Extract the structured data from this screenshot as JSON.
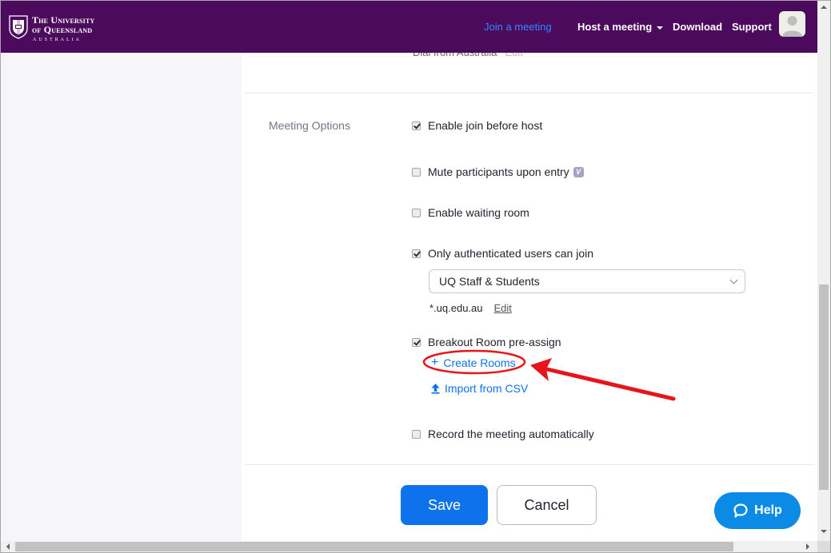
{
  "header": {
    "logo": {
      "line1": "The University",
      "line2": "of Queensland",
      "line3": "AUSTRALIA"
    },
    "nav": {
      "join": "Join a meeting",
      "host": "Host a meeting",
      "download": "Download",
      "support": "Support"
    },
    "colors": {
      "brand": "#4b0a5c",
      "active_link": "#2d8cff"
    }
  },
  "dial": {
    "text": "Dial from Australia",
    "edit": "Edit"
  },
  "meeting_options": {
    "label": "Meeting Options",
    "options": [
      {
        "label": "Enable join before host",
        "checked": true
      },
      {
        "label": "Mute participants upon entry",
        "checked": false,
        "badge": "V"
      },
      {
        "label": "Enable waiting room",
        "checked": false
      },
      {
        "label": "Only authenticated users can join",
        "checked": true
      },
      {
        "label": "Breakout Room pre-assign",
        "checked": true
      },
      {
        "label": "Record the meeting automatically",
        "checked": false
      }
    ],
    "auth_select": {
      "value": "UQ Staff & Students"
    },
    "auth_domain": {
      "text": "*.uq.edu.au",
      "edit": "Edit"
    },
    "breakout": {
      "create_rooms": "Create Rooms",
      "import_csv": "Import from CSV"
    }
  },
  "actions": {
    "save": "Save",
    "cancel": "Cancel"
  },
  "help": {
    "label": "Help"
  },
  "colors": {
    "primary": "#0e72ed",
    "help": "#0b8ae6",
    "annotation": "#e8141b"
  }
}
